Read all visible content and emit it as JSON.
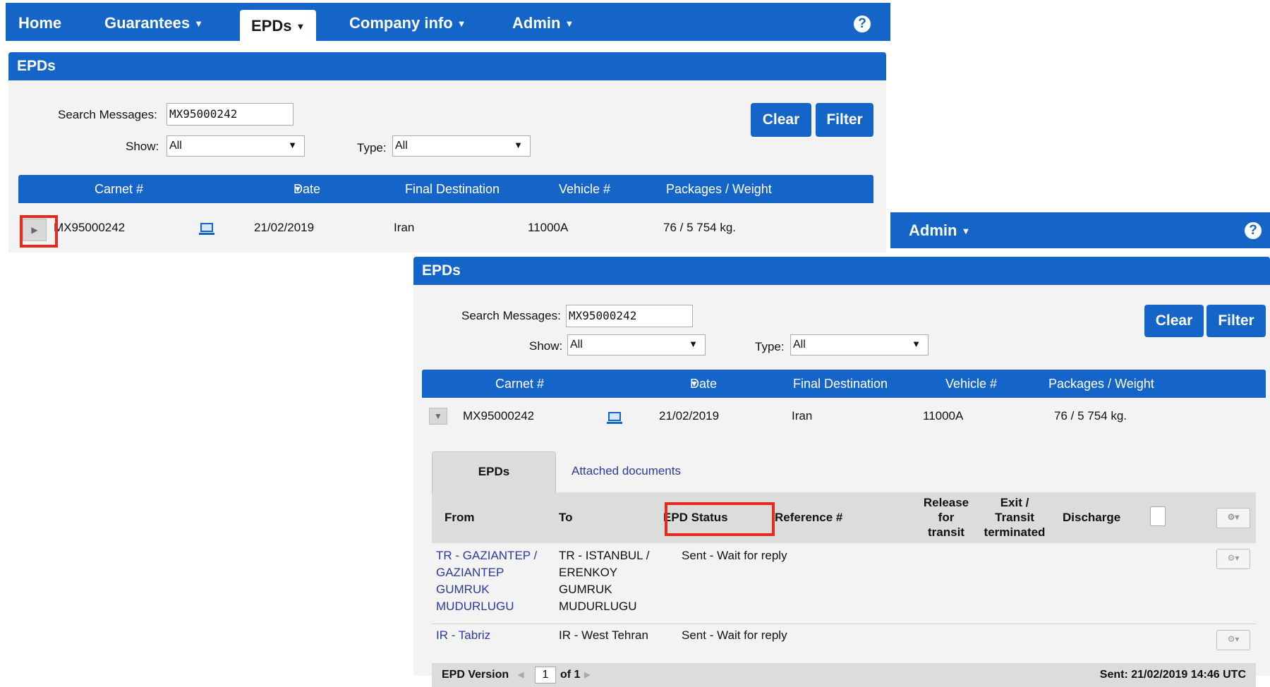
{
  "top": {
    "nav": {
      "home": "Home",
      "guarantees": "Guarantees",
      "epds": "EPDs",
      "company_info": "Company info",
      "admin": "Admin",
      "caret": "▼",
      "help": "?"
    },
    "panel_title": "EPDs",
    "search_label": "Search Messages:",
    "search_value": "MX95000242",
    "show_label": "Show:",
    "show_value": "All",
    "type_label": "Type:",
    "type_value": "All",
    "clear": "Clear",
    "filter": "Filter",
    "columns": {
      "carnet": "Carnet #",
      "date": "Date",
      "final_destination": "Final Destination",
      "vehicle": "Vehicle #",
      "packages": "Packages / Weight"
    },
    "row": {
      "carnet": "MX95000242",
      "date": "21/02/2019",
      "final_destination": "Iran",
      "vehicle": "11000A",
      "packages": "76 / 5 754 kg."
    }
  },
  "bottom": {
    "nav_admin": "Admin",
    "help": "?",
    "panel_title": "EPDs",
    "search_label": "Search Messages:",
    "search_value": "MX95000242",
    "show_label": "Show:",
    "show_value": "All",
    "type_label": "Type:",
    "type_value": "All",
    "clear": "Clear",
    "filter": "Filter",
    "columns": {
      "carnet": "Carnet #",
      "date": "Date",
      "final_destination": "Final Destination",
      "vehicle": "Vehicle #",
      "packages": "Packages / Weight"
    },
    "row": {
      "carnet": "MX95000242",
      "date": "21/02/2019",
      "final_destination": "Iran",
      "vehicle": "11000A",
      "packages": "76 / 5 754 kg."
    },
    "tabs": {
      "epds": "EPDs",
      "attached_documents": "Attached documents"
    },
    "sub_columns": {
      "from": "From",
      "to": "To",
      "epd_status": "EPD Status",
      "reference": "Reference #",
      "release_1": "Release",
      "release_2": "for",
      "release_3": "transit",
      "exit_1": "Exit /",
      "exit_2": "Transit",
      "exit_3": "terminated",
      "discharge": "Discharge"
    },
    "epd_rows": [
      {
        "from_lines": [
          "TR - GAZIANTEP /",
          "GAZIANTEP",
          "GUMRUK",
          "MUDURLUGU"
        ],
        "to_lines": [
          "TR - ISTANBUL /",
          "ERENKOY",
          "GUMRUK",
          "MUDURLUGU"
        ],
        "status": "Sent - Wait for reply"
      },
      {
        "from_lines": [
          "IR - Tabriz"
        ],
        "to_lines": [
          "IR - West Tehran"
        ],
        "status": "Sent - Wait for reply"
      }
    ],
    "footer": {
      "version_label": "EPD Version",
      "page": "1",
      "of": "of 1",
      "sent": "Sent: 21/02/2019 14:46 UTC"
    }
  },
  "colors": {
    "primary_blue": "#1565c8",
    "highlight_red": "#e52b1e",
    "link": "#2a3b9c"
  },
  "icons": [
    "help-icon",
    "monitor-icon",
    "expand-arrow-icon",
    "collapse-arrow-icon",
    "gear-icon",
    "copy-document-icon",
    "dropdown-caret-icon"
  ]
}
